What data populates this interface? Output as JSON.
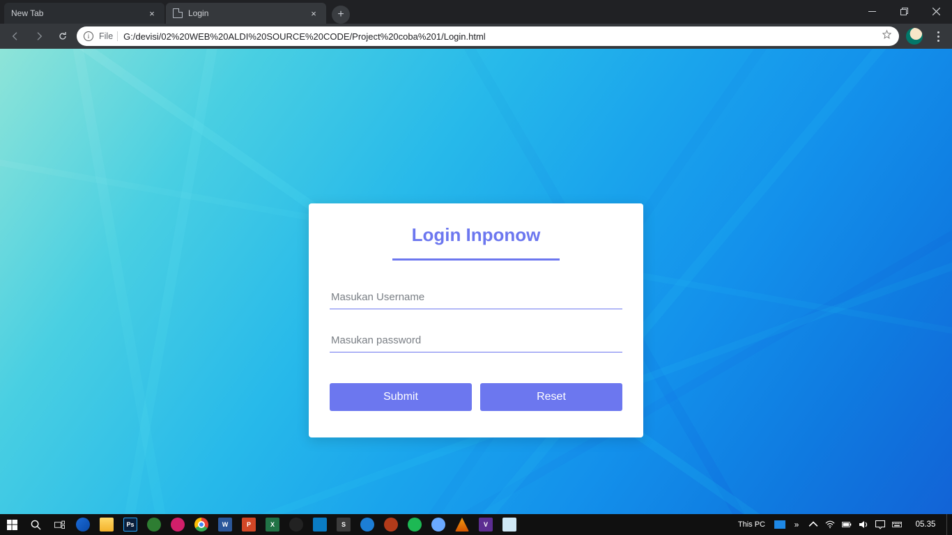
{
  "browser": {
    "tabs": [
      {
        "title": "New Tab"
      },
      {
        "title": "Login"
      }
    ],
    "url_scheme_label": "File",
    "url": "G:/devisi/02%20WEB%20ALDI%20SOURCE%20CODE/Project%20coba%201/Login.html"
  },
  "login": {
    "title": "Login Inponow",
    "username_placeholder": "Masukan Username",
    "password_placeholder": "Masukan password",
    "submit_label": "Submit",
    "reset_label": "Reset"
  },
  "taskbar": {
    "this_pc_label": "This PC",
    "clock": "05.35"
  }
}
